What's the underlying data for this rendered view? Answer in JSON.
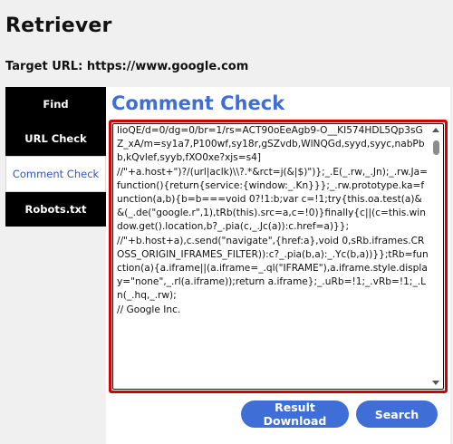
{
  "app": {
    "title": "Retriever"
  },
  "target": {
    "label": "Target URL:",
    "url": "https://www.google.com"
  },
  "sidebar": {
    "items": [
      {
        "label": "Find"
      },
      {
        "label": "URL Check"
      },
      {
        "label": "Comment Check"
      },
      {
        "label": "Robots.txt"
      }
    ]
  },
  "main": {
    "title": "Comment Check",
    "content": "lioQE/d=0/dg=0/br=1/rs=ACT90oEeAgb9-O__KI574HDL5Qp3sGZ_xA/m=sy1a7,P100wf,sy18r,gSZvdb,WlNQGd,syyd,syyc,nabPbb,kQvlef,syyb,fXO0xe?xjs=s4]\n//\"+a.host+\")?/(url|aclk)\\\\?.*&rct=j(&|$)\")};_.E(_.rw,_.Jn);_.rw.Ja=function(){return{service:{window:_.Kn}}};_.rw.prototype.ka=function(a,b){b=b===void 0?!1:b;var c=!1;try{this.oa.test(a)&&(_.de(\"google.r\",1),tRb(this).src=a,c=!0)}finally{c||(c=this.window.get().location,b?_.pia(c,_.Jc(a)):c.href=a)}};\n//\"+b.host+a),c.send(\"navigate\",{href:a},void 0,sRb.iframes.CROSS_ORIGIN_IFRAMES_FILTER)):c?_.pia(b,a):_.Yc(b,a))}};tRb=function(a){a.iframe||(a.iframe=_.ql(\"IFRAME\"),a.iframe.style.display=\"none\",_.rl(a.iframe));return a.iframe};_.uRb=!1;_.vRb=!1;_.Ln(_.hq,_.rw);\n// Google Inc."
  },
  "actions": {
    "download_label": "Result Download",
    "search_label": "Search"
  },
  "colors": {
    "accent": "#3f6fd6",
    "highlight_border": "#d20000",
    "sidebar_bg": "#000000"
  }
}
